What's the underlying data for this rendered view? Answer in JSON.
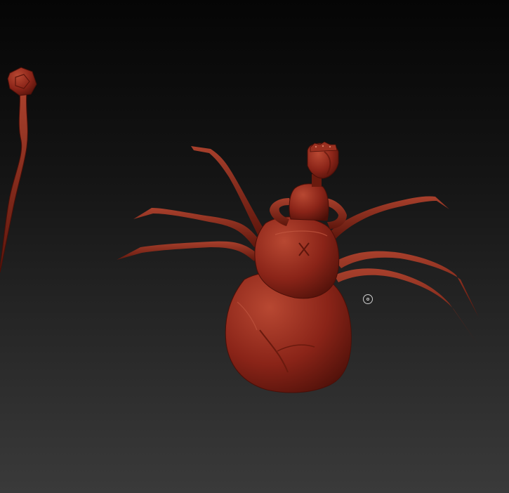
{
  "viewport": {
    "background_top": "#050505",
    "background_bottom": "#3a3a3a"
  },
  "material": {
    "base_color": "#8a2418",
    "highlight_color": "#b84832",
    "shadow_color": "#4a0f08"
  },
  "models": [
    "staff-sculpt",
    "spider-rider-sculpt"
  ],
  "cursor": {
    "icon": "brush-cursor-icon"
  }
}
